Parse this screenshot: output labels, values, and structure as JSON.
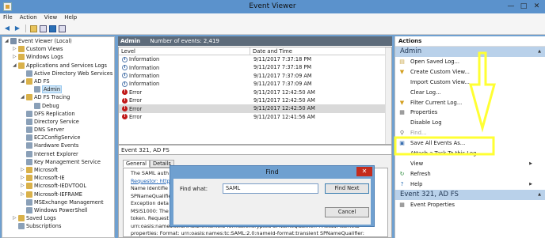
{
  "window": {
    "title": "Event Viewer",
    "min": "—",
    "max": "□",
    "close": "✕"
  },
  "menu": [
    "File",
    "Action",
    "View",
    "Help"
  ],
  "tree": [
    {
      "label": "Event Viewer (Local)",
      "indent": 0,
      "exp": "◢",
      "color": "#7a8fa8"
    },
    {
      "label": "Custom Views",
      "indent": 1,
      "exp": "▷",
      "color": "#d9b14a"
    },
    {
      "label": "Windows Logs",
      "indent": 1,
      "exp": "▷",
      "color": "#d9b14a"
    },
    {
      "label": "Applications and Services Logs",
      "indent": 1,
      "exp": "◢",
      "color": "#d9b14a"
    },
    {
      "label": "Active Directory Web Services",
      "indent": 2,
      "exp": "",
      "color": "#8aa0b8"
    },
    {
      "label": "AD FS",
      "indent": 2,
      "exp": "◢",
      "color": "#d9b14a"
    },
    {
      "label": "Admin",
      "indent": 3,
      "exp": "",
      "color": "#8aa0b8",
      "selected": true
    },
    {
      "label": "AD FS Tracing",
      "indent": 2,
      "exp": "◢",
      "color": "#d9b14a"
    },
    {
      "label": "Debug",
      "indent": 3,
      "exp": "",
      "color": "#8aa0b8"
    },
    {
      "label": "DFS Replication",
      "indent": 2,
      "exp": "",
      "color": "#8aa0b8"
    },
    {
      "label": "Directory Service",
      "indent": 2,
      "exp": "",
      "color": "#8aa0b8"
    },
    {
      "label": "DNS Server",
      "indent": 2,
      "exp": "",
      "color": "#8aa0b8"
    },
    {
      "label": "EC2ConfigService",
      "indent": 2,
      "exp": "",
      "color": "#8aa0b8"
    },
    {
      "label": "Hardware Events",
      "indent": 2,
      "exp": "",
      "color": "#8aa0b8"
    },
    {
      "label": "Internet Explorer",
      "indent": 2,
      "exp": "",
      "color": "#8aa0b8"
    },
    {
      "label": "Key Management Service",
      "indent": 2,
      "exp": "",
      "color": "#8aa0b8"
    },
    {
      "label": "Microsoft",
      "indent": 2,
      "exp": "▷",
      "color": "#d9b14a"
    },
    {
      "label": "Microsoft-IE",
      "indent": 2,
      "exp": "▷",
      "color": "#d9b14a"
    },
    {
      "label": "Microsoft-IEDVTOOL",
      "indent": 2,
      "exp": "▷",
      "color": "#d9b14a"
    },
    {
      "label": "Microsoft-IEFRAME",
      "indent": 2,
      "exp": "▷",
      "color": "#d9b14a"
    },
    {
      "label": "MSExchange Management",
      "indent": 2,
      "exp": "",
      "color": "#8aa0b8"
    },
    {
      "label": "Windows PowerShell",
      "indent": 2,
      "exp": "",
      "color": "#8aa0b8"
    },
    {
      "label": "Saved Logs",
      "indent": 1,
      "exp": "▷",
      "color": "#d9b14a"
    },
    {
      "label": "Subscriptions",
      "indent": 1,
      "exp": "",
      "color": "#8aa0b8"
    }
  ],
  "center": {
    "log_name": "Admin",
    "event_count": "Number of events: 2,419",
    "col_level": "Level",
    "col_date": "Date and Time",
    "events": [
      {
        "level": "Information",
        "date": "9/11/2017 7:37:18 PM",
        "type": "info"
      },
      {
        "level": "Information",
        "date": "9/11/2017 7:37:18 PM",
        "type": "info"
      },
      {
        "level": "Information",
        "date": "9/11/2017 7:37:09 AM",
        "type": "info"
      },
      {
        "level": "Information",
        "date": "9/11/2017 7:37:09 AM",
        "type": "info"
      },
      {
        "level": "Error",
        "date": "9/11/2017 12:42:50 AM",
        "type": "error"
      },
      {
        "level": "Error",
        "date": "9/11/2017 12:42:50 AM",
        "type": "error"
      },
      {
        "level": "Error",
        "date": "9/11/2017 12:42:50 AM",
        "type": "error",
        "selected": true
      },
      {
        "level": "Error",
        "date": "9/11/2017 12:41:56 AM",
        "type": "error"
      }
    ],
    "detail_title": "Event 321, AD FS",
    "tab_general": "General",
    "tab_details": "Details",
    "detail_lines": [
      {
        "text": "The SAML auth",
        "link": false
      },
      {
        "text": "Requestor: http",
        "link": true
      },
      {
        "text": "Name identifie",
        "link": false
      },
      {
        "text": "SPNameQualifie",
        "link": false
      },
      {
        "text": "Exception deta",
        "link": false
      },
      {
        "text": "MSIS1000: The",
        "link": false
      },
      {
        "text": "token. Request",
        "link": false
      },
      {
        "text": "urn:oasis:names:tc:SAML:2.0:nameid-format:encrypted SPNameQualifier: . Actual NameID",
        "link": false
      },
      {
        "text": "properties: Format: urn:oasis:names:tc:SAML:2.0:nameid-format:transient SPNameQualifier:",
        "link": false
      }
    ]
  },
  "actions": {
    "title": "Actions",
    "section1": "Admin",
    "items1": [
      {
        "label": "Open Saved Log...",
        "icon": "▤",
        "color": "#c9a445"
      },
      {
        "label": "Create Custom View...",
        "icon": "▼",
        "color": "#d4a020"
      },
      {
        "label": "Import Custom View...",
        "icon": "",
        "color": "#999"
      },
      {
        "label": "Clear Log...",
        "icon": "",
        "color": "#999"
      },
      {
        "label": "Filter Current Log...",
        "icon": "▼",
        "color": "#d4a020"
      },
      {
        "label": "Properties",
        "icon": "▦",
        "color": "#666"
      },
      {
        "label": "Disable Log",
        "icon": "",
        "color": "#999"
      },
      {
        "label": "Find...",
        "icon": "⚲",
        "color": "#666",
        "disabled": true
      },
      {
        "label": "Save All Events As...",
        "icon": "▣",
        "color": "#3a6fb0"
      },
      {
        "label": "Attach a Task To this Log...",
        "icon": "",
        "color": "#999"
      },
      {
        "label": "View",
        "icon": "",
        "color": "#999",
        "submenu": true
      },
      {
        "label": "Refresh",
        "icon": "↻",
        "color": "#2a8a3a"
      },
      {
        "label": "Help",
        "icon": "?",
        "color": "#2a6fb5",
        "submenu": true
      }
    ],
    "section2": "Event 321, AD FS",
    "items2": [
      {
        "label": "Event Properties",
        "icon": "▦",
        "color": "#666"
      }
    ]
  },
  "find_dialog": {
    "title": "Find",
    "label": "Find what:",
    "value": "SAML",
    "find_next": "Find Next",
    "cancel": "Cancel",
    "close": "✕"
  },
  "annotation_color": "#ffff33"
}
